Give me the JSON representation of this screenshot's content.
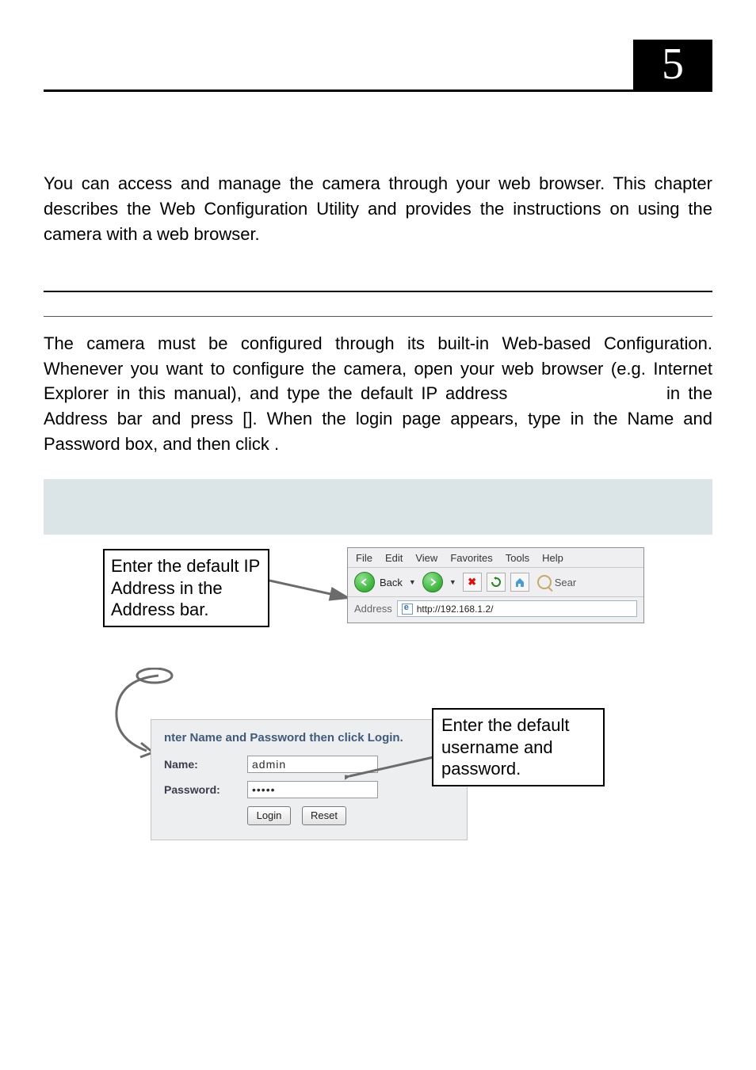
{
  "chapter": {
    "number": "5"
  },
  "intro": "You can access and manage the camera through your web browser.  This chapter describes the Web Configuration Utility and provides the instructions on using the camera with a web browser.",
  "body": {
    "p1a": "The camera must be configured through its built-in Web-based Configuration. Whenever you want to configure the camera, open your web browser (e.g. Internet Explorer in this manual), and type the default IP address ",
    "ip_placeholder": "",
    "p1b": " in the Address bar and press [",
    "key": "",
    "p1c": "].  When the login page appears, type ",
    "creds": "",
    "p1d": " in the Name and Password box, and then click ",
    "button_word": "",
    "p1e": "."
  },
  "note": "",
  "callouts": {
    "address_bar": "Enter the default IP Address in the Address bar.",
    "credentials": "Enter the default username and password."
  },
  "ie": {
    "menu": {
      "file": "File",
      "edit": "Edit",
      "view": "View",
      "favorites": "Favorites",
      "tools": "Tools",
      "help": "Help"
    },
    "toolbar": {
      "back": "Back",
      "search": "Sear"
    },
    "address": {
      "label": "Address",
      "url": "http://192.168.1.2/"
    }
  },
  "login": {
    "title": "nter Name and Password then click Login.",
    "name_label": "Name:",
    "name_value": "admin",
    "password_label": "Password:",
    "password_value": "•••••",
    "login_btn": "Login",
    "reset_btn": "Reset"
  }
}
